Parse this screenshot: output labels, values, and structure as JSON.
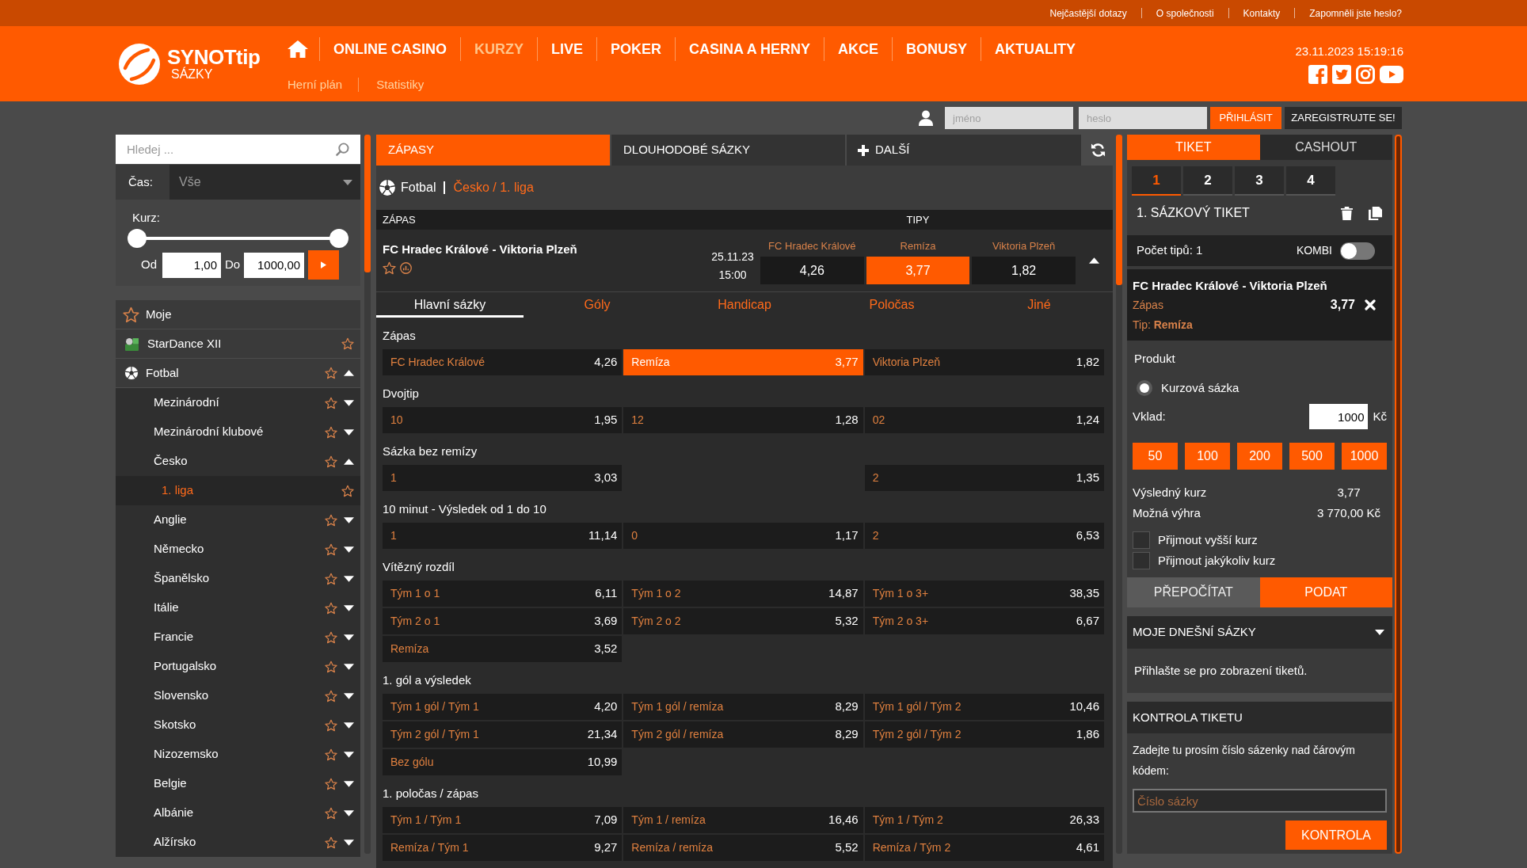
{
  "top_links": [
    "Nejčastější dotazy",
    "O společnosti",
    "Kontakty",
    "Zapomněli jste heslo?"
  ],
  "header": {
    "logo": {
      "name": "SYNOTtip",
      "subtitle": "SÁZKY"
    },
    "nav": [
      {
        "label": "ONLINE CASINO",
        "selected": false
      },
      {
        "label": "KURZY",
        "selected": true
      },
      {
        "label": "LIVE",
        "selected": false
      },
      {
        "label": "POKER",
        "selected": false
      },
      {
        "label": "CASINA A HERNY",
        "selected": false
      },
      {
        "label": "AKCE",
        "selected": false
      },
      {
        "label": "BONUSY",
        "selected": false
      },
      {
        "label": "AKTUALITY",
        "selected": false
      }
    ],
    "subnav": [
      "Herní plán",
      "Statistiky"
    ],
    "datetime": "23.11.2023 15:19:16"
  },
  "login": {
    "username": {
      "placeholder": "jméno"
    },
    "password": {
      "placeholder": "heslo"
    },
    "login_button": "PŘIHLÁSIT",
    "register_button": "ZAREGISTRUJTE SE!"
  },
  "filters": {
    "search": {
      "placeholder": "Hledej ..."
    },
    "time": {
      "label": "Čas:",
      "value": "Vše"
    },
    "odds": {
      "label": "Kurz:",
      "thumbs": [
        {
          "level": 0
        },
        {
          "level": 1
        }
      ],
      "from": {
        "label": "Od",
        "value": "1,00"
      },
      "to": {
        "label": "Do",
        "value": "1000,00"
      }
    }
  },
  "sidebar": {
    "items": [
      {
        "kind": "favorites",
        "label": "Moje",
        "selected": false
      },
      {
        "kind": "show",
        "label": "StarDance XII",
        "selected": false
      },
      {
        "kind": "soccer",
        "label": "Fotbal",
        "selected": false,
        "expanded": true,
        "children": [
          {
            "label": "Mezinárodní",
            "selected": false,
            "expanded": false
          },
          {
            "label": "Mezinárodní klubové",
            "selected": false,
            "expanded": false
          },
          {
            "label": "Česko",
            "selected": false,
            "expanded": true,
            "children": [
              {
                "label": "1. liga",
                "selected": true
              }
            ]
          },
          {
            "label": "Anglie",
            "selected": false,
            "expanded": false
          },
          {
            "label": "Německo",
            "selected": false,
            "expanded": false
          },
          {
            "label": "Španělsko",
            "selected": false,
            "expanded": false
          },
          {
            "label": "Itálie",
            "selected": false,
            "expanded": false
          },
          {
            "label": "Francie",
            "selected": false,
            "expanded": false
          },
          {
            "label": "Portugalsko",
            "selected": false,
            "expanded": false
          },
          {
            "label": "Slovensko",
            "selected": false,
            "expanded": false
          },
          {
            "label": "Skotsko",
            "selected": false,
            "expanded": false
          },
          {
            "label": "Nizozemsko",
            "selected": false,
            "expanded": false
          },
          {
            "label": "Belgie",
            "selected": false,
            "expanded": false
          },
          {
            "label": "Albánie",
            "selected": false,
            "expanded": false
          },
          {
            "label": "Alžírsko",
            "selected": false,
            "expanded": false
          }
        ]
      }
    ]
  },
  "main": {
    "tabs": [
      {
        "label": "ZÁPASY",
        "selected": true
      },
      {
        "label": "DLOUHODOBÉ SÁZKY",
        "selected": false
      }
    ],
    "more_tab": {
      "label": "DALŠÍ"
    },
    "breadcrumb": {
      "sport": "Fotbal",
      "path": "Česko / 1. liga"
    },
    "table": {
      "columns": [
        "ZÁPAS",
        "TIPY"
      ],
      "match": {
        "name": "FC Hradec Králové - Viktoria Plzeň",
        "date": "25.11.23",
        "time": "15:00",
        "expanded": true,
        "odds": [
          {
            "label": "FC Hradec Králové",
            "value": "4,26",
            "selected": false
          },
          {
            "label": "Remíza",
            "value": "3,77",
            "selected": true
          },
          {
            "label": "Viktoria Plzeň",
            "value": "1,82",
            "selected": false
          }
        ]
      }
    },
    "market_tabs": [
      {
        "label": "Hlavní sázky",
        "selected": true
      },
      {
        "label": "Góly",
        "selected": false
      },
      {
        "label": "Handicap",
        "selected": false
      },
      {
        "label": "Poločas",
        "selected": false
      },
      {
        "label": "Jiné",
        "selected": false
      }
    ],
    "markets": [
      {
        "title": "Zápas",
        "rows": [
          [
            {
              "label": "FC Hradec Králové",
              "odd": "4,26",
              "selected": false
            },
            {
              "label": "Remíza",
              "odd": "3,77",
              "selected": true
            },
            {
              "label": "Viktoria Plzeň",
              "odd": "1,82",
              "selected": false
            }
          ]
        ]
      },
      {
        "title": "Dvojtip",
        "rows": [
          [
            {
              "label": "10",
              "odd": "1,95",
              "selected": false
            },
            {
              "label": "12",
              "odd": "1,28",
              "selected": false
            },
            {
              "label": "02",
              "odd": "1,24",
              "selected": false
            }
          ]
        ]
      },
      {
        "title": "Sázka bez remízy",
        "rows": [
          [
            {
              "label": "1",
              "odd": "3,03",
              "selected": false
            },
            null,
            {
              "label": "2",
              "odd": "1,35",
              "selected": false
            }
          ]
        ]
      },
      {
        "title": "10 minut - Výsledek od 1 do 10",
        "rows": [
          [
            {
              "label": "1",
              "odd": "11,14",
              "selected": false
            },
            {
              "label": "0",
              "odd": "1,17",
              "selected": false
            },
            {
              "label": "2",
              "odd": "6,53",
              "selected": false
            }
          ]
        ]
      },
      {
        "title": "Vítězný rozdíl",
        "rows": [
          [
            {
              "label": "Tým 1 o 1",
              "odd": "6,11",
              "selected": false
            },
            {
              "label": "Tým 1 o 2",
              "odd": "14,87",
              "selected": false
            },
            {
              "label": "Tým 1 o 3+",
              "odd": "38,35",
              "selected": false
            }
          ],
          [
            {
              "label": "Tým 2 o 1",
              "odd": "3,69",
              "selected": false
            },
            {
              "label": "Tým 2 o 2",
              "odd": "5,32",
              "selected": false
            },
            {
              "label": "Tým 2 o 3+",
              "odd": "6,67",
              "selected": false
            }
          ],
          [
            {
              "label": "Remíza",
              "odd": "3,52",
              "selected": false
            }
          ]
        ]
      },
      {
        "title": "1. gól a výsledek",
        "rows": [
          [
            {
              "label": "Tým 1 gól / Tým 1",
              "odd": "4,20",
              "selected": false
            },
            {
              "label": "Tým 1 gól / remíza",
              "odd": "8,29",
              "selected": false
            },
            {
              "label": "Tým 1 gól / Tým 2",
              "odd": "10,46",
              "selected": false
            }
          ],
          [
            {
              "label": "Tým 2 gól / Tým 1",
              "odd": "21,34",
              "selected": false
            },
            {
              "label": "Tým 2 gól / remíza",
              "odd": "8,29",
              "selected": false
            },
            {
              "label": "Tým 2 gól / Tým 2",
              "odd": "1,86",
              "selected": false
            }
          ],
          [
            {
              "label": "Bez gólu",
              "odd": "10,99",
              "selected": false
            }
          ]
        ]
      },
      {
        "title": "1. poločas / zápas",
        "rows": [
          [
            {
              "label": "Tým 1 / Tým 1",
              "odd": "7,09",
              "selected": false
            },
            {
              "label": "Tým 1 / remíza",
              "odd": "16,46",
              "selected": false
            },
            {
              "label": "Tým 1 / Tým 2",
              "odd": "26,33",
              "selected": false
            }
          ],
          [
            {
              "label": "Remíza / Tým 1",
              "odd": "9,27",
              "selected": false
            },
            {
              "label": "Remíza / remíza",
              "odd": "5,52",
              "selected": false
            },
            {
              "label": "Remíza / Tým 2",
              "odd": "4,61",
              "selected": false
            }
          ]
        ]
      }
    ]
  },
  "ticket": {
    "tabs": [
      {
        "label": "TIKET",
        "selected": true
      },
      {
        "label": "CASHOUT",
        "selected": false
      }
    ],
    "slots": [
      {
        "label": "1",
        "selected": true
      },
      {
        "label": "2",
        "selected": false
      },
      {
        "label": "3",
        "selected": false
      },
      {
        "label": "4",
        "selected": false
      }
    ],
    "title": "1. SÁZKOVÝ TIKET",
    "tip_count": "Počet tipů: 1",
    "kombi": {
      "label": "KOMBI",
      "on": false
    },
    "bet": {
      "match": "FC Hradec Králové - Viktoria Plzeň",
      "market": "Zápas",
      "odd": "3,77",
      "tip": "Tip: **Remíza**"
    },
    "product": {
      "title": "Produkt",
      "options": [
        {
          "label": "Kurzová sázka",
          "selected": true
        }
      ]
    },
    "stake": {
      "label": "Vklad:",
      "value": "1000",
      "currency": "Kč"
    },
    "quick_amounts": [
      "50",
      "100",
      "200",
      "500",
      "1000"
    ],
    "summary": [
      {
        "label": "Výsledný kurz",
        "value": "3,77"
      },
      {
        "label": "Možná výhra",
        "value": "3 770,00 Kč"
      }
    ],
    "options": [
      {
        "label": "Přijmout vyšší kurz",
        "checked": false
      },
      {
        "label": "Přijmout jakýkoliv kurz",
        "checked": false
      }
    ],
    "buttons": [
      {
        "label": "PŘEPOČÍTAT",
        "kind": "secondary"
      },
      {
        "label": "PODAT",
        "kind": "primary"
      }
    ]
  },
  "my_bets": {
    "title": "MOJE DNEŠNÍ SÁZKY",
    "text": "Přihlašte se pro zobrazení tiketů."
  },
  "ticket_check": {
    "title": "KONTROLA TIKETU",
    "text": "Zadejte tu prosím číslo sázenky nad čárovým kódem:",
    "input": {
      "placeholder": "Číslo sázky"
    },
    "button": "KONTROLA"
  }
}
